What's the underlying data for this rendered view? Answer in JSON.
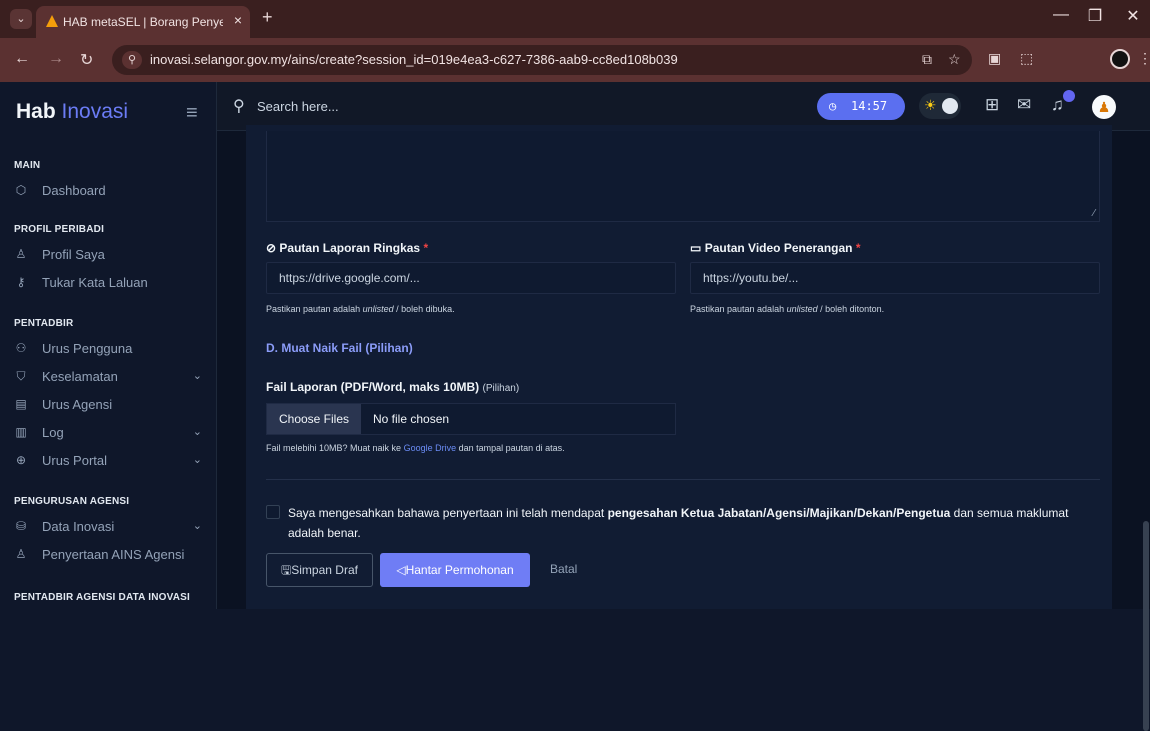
{
  "browser": {
    "tab_title": "HAB metaSEL | Borang Penyertaan",
    "tab_close": "×",
    "new_tab": "+",
    "url": "inovasi.selangor.gov.my/ains/create?session_id=019e4ea3-c627-7386-aab9-cc8ed108b039"
  },
  "brand": {
    "main": "Hab",
    "sub": "Inovasi"
  },
  "sidebar": {
    "sections": [
      {
        "title": "MAIN",
        "items": [
          {
            "label": "Dashboard",
            "icon": "cube-icon",
            "chevron": false
          }
        ]
      },
      {
        "title": "PROFIL PERIBADI",
        "items": [
          {
            "label": "Profil Saya",
            "icon": "user-icon",
            "chevron": false
          },
          {
            "label": "Tukar Kata Laluan",
            "icon": "key-icon",
            "chevron": false
          }
        ]
      },
      {
        "title": "PENTADBIR",
        "items": [
          {
            "label": "Urus Pengguna",
            "icon": "users-icon",
            "chevron": false
          },
          {
            "label": "Keselamatan",
            "icon": "shield-icon",
            "chevron": true
          },
          {
            "label": "Urus Agensi",
            "icon": "building-icon",
            "chevron": false
          },
          {
            "label": "Log",
            "icon": "log-icon",
            "chevron": true
          },
          {
            "label": "Urus Portal",
            "icon": "globe-icon",
            "chevron": true
          }
        ]
      },
      {
        "title": "PENGURUSAN AGENSI",
        "items": [
          {
            "label": "Data Inovasi",
            "icon": "database-icon",
            "chevron": true
          },
          {
            "label": "Penyertaan AINS Agensi",
            "icon": "award-icon",
            "chevron": false
          }
        ]
      },
      {
        "title": "PENTADBIR AGENSI DATA INOVASI",
        "items": []
      }
    ]
  },
  "header": {
    "search_placeholder": "Search here...",
    "clock": "14:57"
  },
  "form": {
    "report_link": {
      "label": "Pautan Laporan Ringkas",
      "required_mark": "*",
      "placeholder": "https://drive.google.com/...",
      "hint_prefix": "Pastikan pautan adalah ",
      "hint_em": "unlisted",
      "hint_suffix": " / boleh dibuka."
    },
    "video_link": {
      "label": "Pautan Video Penerangan",
      "required_mark": "*",
      "placeholder": "https://youtu.be/...",
      "hint_prefix": "Pastikan pautan adalah ",
      "hint_em": "unlisted",
      "hint_suffix": " / boleh ditonton."
    },
    "section_d": "D. Muat Naik Fail (Pilihan)",
    "file": {
      "label": "Fail Laporan (PDF/Word, maks 10MB)",
      "optional": "(Pilihan)",
      "button": "Choose Files",
      "status": "No file chosen",
      "hint_prefix": "Fail melebihi 10MB? Muat naik ke ",
      "hint_link": "Google Drive",
      "hint_suffix": " dan tampal pautan di atas."
    },
    "declaration": {
      "prefix": "Saya mengesahkan bahawa penyertaan ini telah mendapat ",
      "bold": "pengesahan Ketua Jabatan/Agensi/Majikan/Dekan/Pengetua",
      "suffix": " dan semua maklumat adalah benar."
    },
    "buttons": {
      "draft": "Simpan Draf",
      "submit": "Hantar Permohonan",
      "cancel": "Batal"
    }
  }
}
